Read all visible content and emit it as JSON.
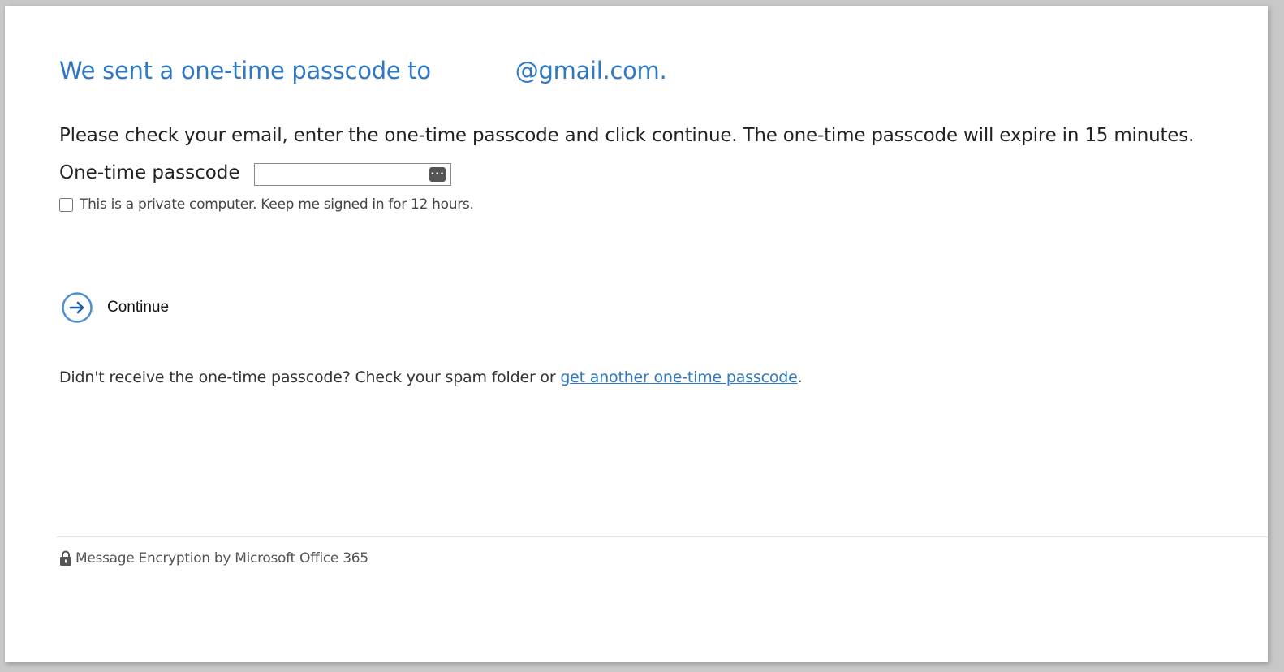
{
  "header": {
    "title_prefix": "We sent a one-time passcode to",
    "title_email": "@gmail.com."
  },
  "instructions": "Please check your email, enter the one-time passcode and click continue. The one-time passcode will expire in 15 minutes.",
  "otp": {
    "label": "One-time passcode",
    "value": "",
    "placeholder": "",
    "icon": "password-manager-key-icon"
  },
  "remember": {
    "label": "This is a private computer. Keep me signed in for 12 hours.",
    "checked": false
  },
  "continue": {
    "label": "Continue",
    "icon": "arrow-right-circle-icon"
  },
  "resend": {
    "text_before": "Didn't receive the one-time passcode? Check your spam folder or ",
    "link_label": "get another one-time passcode",
    "text_after": "."
  },
  "footer": {
    "text": "Message Encryption by Microsoft Office 365",
    "icon": "lock-icon"
  },
  "colors": {
    "accent": "#2f78c4",
    "text": "#222222",
    "page_background": "#ffffff",
    "frame_background": "#c8c8c8"
  }
}
